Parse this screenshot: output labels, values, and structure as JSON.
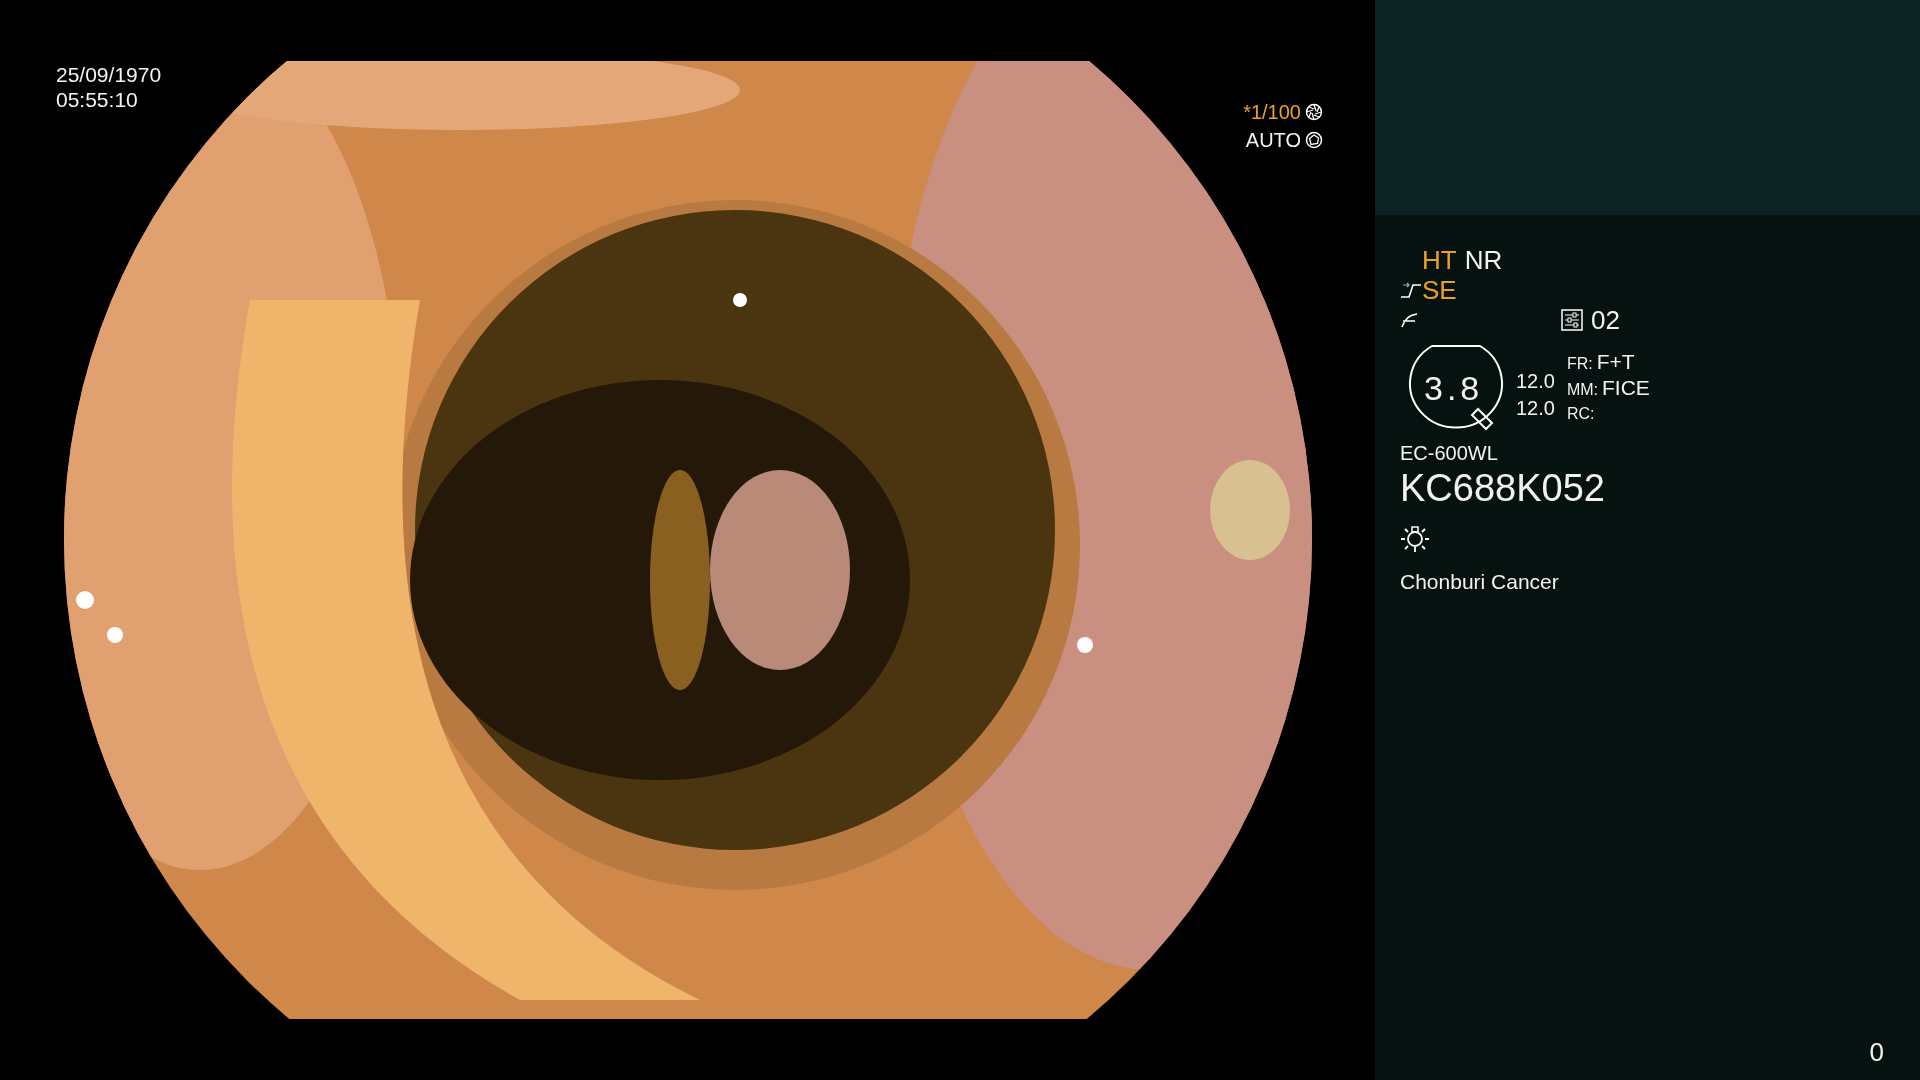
{
  "timestamp": {
    "date": "25/09/1970",
    "time": "05:55:10"
  },
  "shutter": {
    "speed": "*1/100",
    "speed_on": true,
    "mode": "AUTO"
  },
  "panel": {
    "modes": [
      {
        "label": "HT",
        "on": true
      },
      {
        "label": "NR",
        "on": false
      }
    ],
    "enhance": {
      "label": "SE",
      "on": true
    },
    "preset": "02",
    "zoom": "3.8",
    "readings": [
      "12.0",
      "12.0"
    ],
    "settings": [
      {
        "key": "FR:",
        "value": "F+T"
      },
      {
        "key": "MM:",
        "value": "FICE"
      },
      {
        "key": "RC:"
      }
    ],
    "model": "EC-600WL",
    "serial": "KC688K052",
    "institution": "Chonburi Cancer"
  },
  "counter": "0"
}
